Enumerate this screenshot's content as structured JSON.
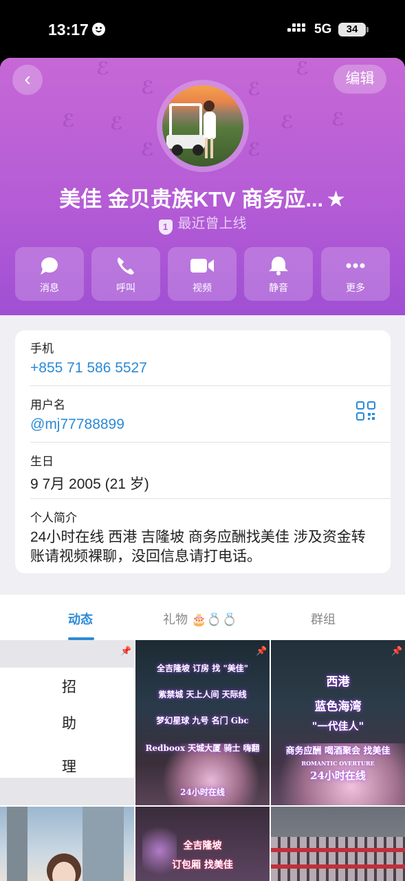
{
  "status": {
    "time": "13:17",
    "network": "5G",
    "battery": "34"
  },
  "header": {
    "edit_label": "编辑",
    "name": "美佳 金贝贵族KTV 商务应...",
    "online_badge": "1",
    "online_status": "最近曾上线",
    "accent": "#b55cd6"
  },
  "actions": [
    {
      "label": "消息",
      "icon": "message-icon"
    },
    {
      "label": "呼叫",
      "icon": "phone-icon"
    },
    {
      "label": "视频",
      "icon": "video-icon"
    },
    {
      "label": "静音",
      "icon": "bell-icon"
    },
    {
      "label": "更多",
      "icon": "more-icon"
    }
  ],
  "info": {
    "phone_label": "手机",
    "phone": "+855 71 586 5527",
    "username_label": "用户名",
    "username": "@mj77788899",
    "birthday_label": "生日",
    "birthday": "9 7月 2005 (21 岁)",
    "bio_label": "个人简介",
    "bio": "24小时在线 西港 吉隆坡 商务应酬找美佳 涉及资金转账请视频裸聊，没回信息请打电话。",
    "link_color": "#2b8ad6"
  },
  "tabs": {
    "posts": "动态",
    "gifts": "礼物",
    "gift_emojis": "🎂💍💍",
    "groups": "群组"
  },
  "posts": {
    "p1": [
      "招",
      "助",
      "理"
    ],
    "p2": [
      "全吉隆坡 订房 找 \"美佳\"",
      "紫禁城 天上人间 天际线",
      "梦幻星球 九号 名门 Gbc",
      "Redboox 天城大厦 骑士 嗨翻",
      "24小时在线"
    ],
    "p3": [
      "西港",
      "蓝色海湾",
      "\"一代佳人\"",
      "商务应酬 喝酒聚会 找美佳",
      "ROMANTIC OVERTURE",
      "24小时在线"
    ],
    "p5": [
      "全吉隆坡",
      "订包厢 找美佳"
    ]
  }
}
